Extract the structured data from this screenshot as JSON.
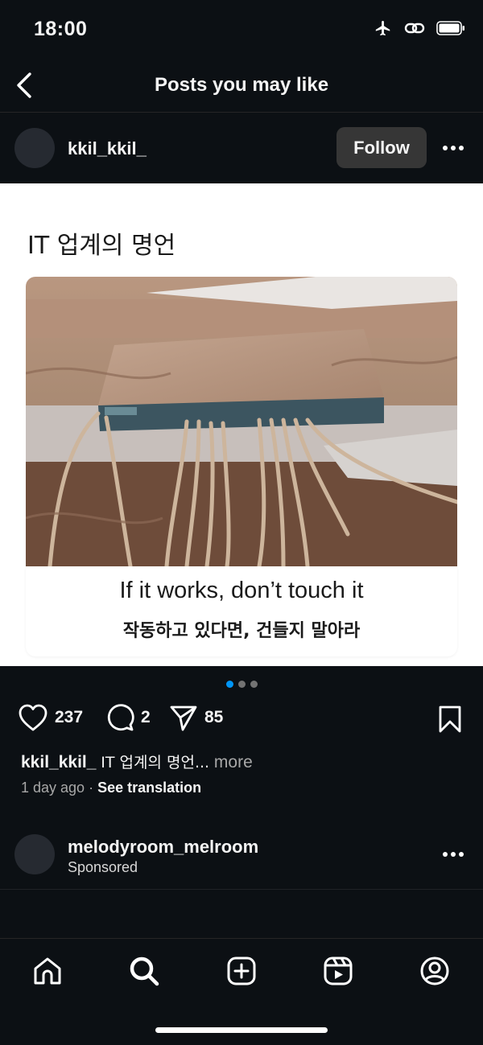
{
  "status_bar": {
    "time": "18:00",
    "icons": [
      "airplane-icon",
      "link-icon",
      "battery-icon"
    ]
  },
  "header": {
    "title": "Posts you may like",
    "back_icon": "chevron-left-icon"
  },
  "post": {
    "username": "kkil_kkil_",
    "follow_label": "Follow",
    "more_icon": "ellipsis-icon",
    "media": {
      "title": "IT 업계의 명언",
      "caption_en": "If it works, don’t touch it",
      "caption_ko": "작동하고 있다면, 건들지 말아라",
      "carousel": {
        "count": 3,
        "active": 0
      }
    },
    "likes": "237",
    "comments": "2",
    "shares": "85",
    "caption_user": "kkil_kkil_",
    "caption_text": "IT 업계의 명언...",
    "caption_more": "more",
    "time_ago": "1 day ago",
    "separator": "·",
    "see_translation": "See translation"
  },
  "sponsored": {
    "username": "melodyroom_melroom",
    "label": "Sponsored"
  },
  "bottom_nav": {
    "items": [
      "home-icon",
      "search-icon",
      "create-icon",
      "reels-icon",
      "profile-icon"
    ]
  },
  "colors": {
    "background": "#0c1014",
    "accent": "#0095f6",
    "follow_button": "#363636"
  }
}
